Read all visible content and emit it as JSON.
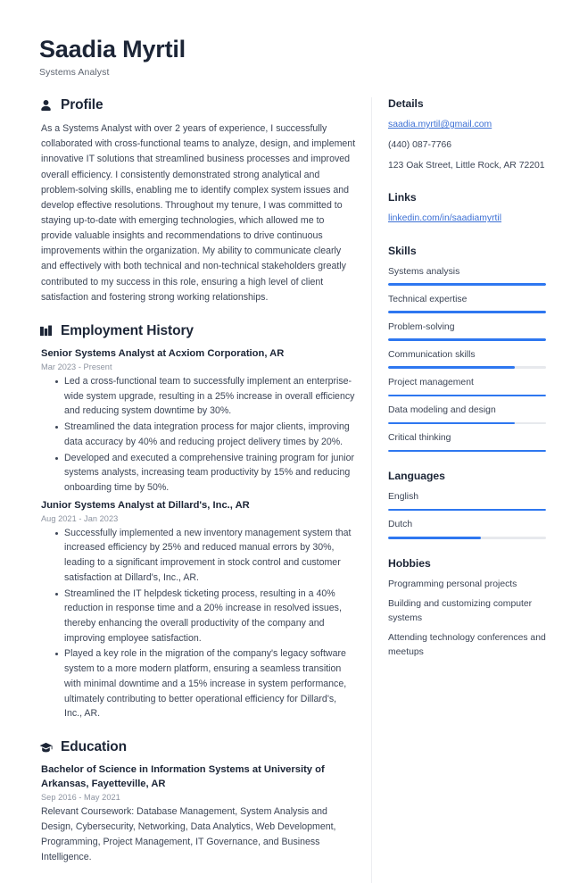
{
  "theme": {
    "accent": "#2e77f0",
    "link": "#3b6fd4",
    "heading": "#1c2536",
    "body_text": "#3c4556",
    "muted": "#8c93a0",
    "track": "#e7e9ed",
    "background": "#ffffff"
  },
  "header": {
    "name": "Saadia Myrtil",
    "title": "Systems Analyst"
  },
  "sections": {
    "profile": {
      "title": "Profile",
      "icon": "user-icon",
      "text": "As a Systems Analyst with over 2 years of experience, I successfully collaborated with cross-functional teams to analyze, design, and implement innovative IT solutions that streamlined business processes and improved overall efficiency. I consistently demonstrated strong analytical and problem-solving skills, enabling me to identify complex system issues and develop effective resolutions. Throughout my tenure, I was committed to staying up-to-date with emerging technologies, which allowed me to provide valuable insights and recommendations to drive continuous improvements within the organization. My ability to communicate clearly and effectively with both technical and non-technical stakeholders greatly contributed to my success in this role, ensuring a high level of client satisfaction and fostering strong working relationships."
    },
    "employment": {
      "title": "Employment History",
      "icon": "briefcase-icon",
      "entries": [
        {
          "title": "Senior Systems Analyst at Acxiom Corporation, AR",
          "date": "Mar 2023 - Present",
          "bullets": [
            "Led a cross-functional team to successfully implement an enterprise-wide system upgrade, resulting in a 25% increase in overall efficiency and reducing system downtime by 30%.",
            "Streamlined the data integration process for major clients, improving data accuracy by 40% and reducing project delivery times by 20%.",
            "Developed and executed a comprehensive training program for junior systems analysts, increasing team productivity by 15% and reducing onboarding time by 50%."
          ]
        },
        {
          "title": "Junior Systems Analyst at Dillard's, Inc., AR",
          "date": "Aug 2021 - Jan 2023",
          "bullets": [
            "Successfully implemented a new inventory management system that increased efficiency by 25% and reduced manual errors by 30%, leading to a significant improvement in stock control and customer satisfaction at Dillard's, Inc., AR.",
            "Streamlined the IT helpdesk ticketing process, resulting in a 40% reduction in response time and a 20% increase in resolved issues, thereby enhancing the overall productivity of the company and improving employee satisfaction.",
            "Played a key role in the migration of the company's legacy software system to a more modern platform, ensuring a seamless transition with minimal downtime and a 15% increase in system performance, ultimately contributing to better operational efficiency for Dillard's, Inc., AR."
          ]
        }
      ]
    },
    "education": {
      "title": "Education",
      "icon": "graduation-cap-icon",
      "entries": [
        {
          "title": "Bachelor of Science in Information Systems at University of Arkansas, Fayetteville, AR",
          "date": "Sep 2016 - May 2021",
          "description": "Relevant Coursework: Database Management, System Analysis and Design, Cybersecurity, Networking, Data Analytics, Web Development, Programming, Project Management, IT Governance, and Business Intelligence."
        }
      ]
    }
  },
  "sidebar": {
    "details": {
      "title": "Details",
      "email": "saadia.myrtil@gmail.com",
      "phone": "(440) 087-7766",
      "address": "123 Oak Street, Little Rock, AR 72201"
    },
    "links": {
      "title": "Links",
      "items": [
        {
          "label": "linkedin.com/in/saadiamyrtil"
        }
      ]
    },
    "skills": {
      "title": "Skills",
      "items": [
        {
          "label": "Systems analysis",
          "level": 100
        },
        {
          "label": "Technical expertise",
          "level": 100
        },
        {
          "label": "Problem-solving",
          "level": 100
        },
        {
          "label": "Communication skills",
          "level": 80
        },
        {
          "label": "Project management",
          "level": 100
        },
        {
          "label": "Data modeling and design",
          "level": 80
        },
        {
          "label": "Critical thinking",
          "level": 100
        }
      ]
    },
    "languages": {
      "title": "Languages",
      "items": [
        {
          "label": "English",
          "level": 100
        },
        {
          "label": "Dutch",
          "level": 59
        }
      ]
    },
    "hobbies": {
      "title": "Hobbies",
      "items": [
        {
          "label": "Programming personal projects"
        },
        {
          "label": "Building and customizing computer systems"
        },
        {
          "label": "Attending technology conferences and meetups"
        }
      ]
    }
  }
}
